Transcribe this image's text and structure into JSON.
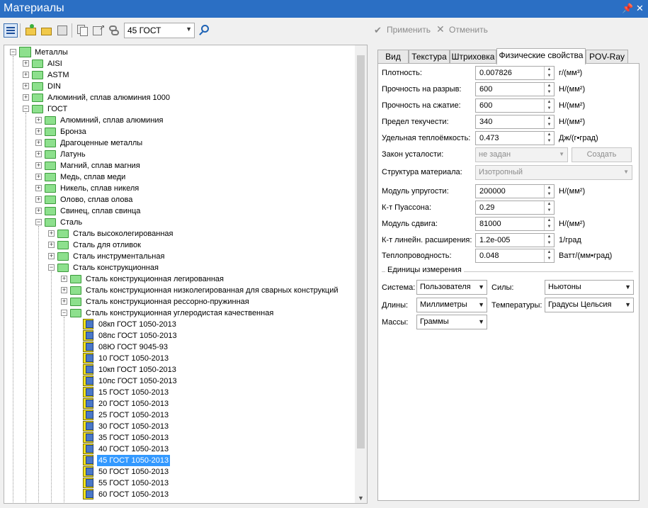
{
  "window": {
    "title": "Материалы",
    "pin_glyph": "📌",
    "close_glyph": "✕"
  },
  "toolbar": {
    "material_combo": "45 ГОСТ",
    "apply_label": "Применить",
    "cancel_label": "Отменить"
  },
  "tree": {
    "nodes": [
      {
        "label": "Металлы",
        "level": 0,
        "type": "root",
        "expanded": true
      },
      {
        "label": "AISI",
        "level": 1,
        "type": "folder",
        "expanded": false
      },
      {
        "label": "ASTM",
        "level": 1,
        "type": "folder",
        "expanded": false
      },
      {
        "label": "DIN",
        "level": 1,
        "type": "folder",
        "expanded": false
      },
      {
        "label": "Алюминий, сплав алюминия 1000",
        "level": 1,
        "type": "folder",
        "expanded": false
      },
      {
        "label": "ГОСТ",
        "level": 1,
        "type": "folder",
        "expanded": true
      },
      {
        "label": "Алюминий, сплав алюминия",
        "level": 2,
        "type": "folder",
        "expanded": false
      },
      {
        "label": "Бронза",
        "level": 2,
        "type": "folder",
        "expanded": false
      },
      {
        "label": "Драгоценные металлы",
        "level": 2,
        "type": "folder",
        "expanded": false
      },
      {
        "label": "Латунь",
        "level": 2,
        "type": "folder",
        "expanded": false
      },
      {
        "label": "Магний, сплав магния",
        "level": 2,
        "type": "folder",
        "expanded": false
      },
      {
        "label": "Медь, сплав меди",
        "level": 2,
        "type": "folder",
        "expanded": false
      },
      {
        "label": "Никель, сплав никеля",
        "level": 2,
        "type": "folder",
        "expanded": false
      },
      {
        "label": "Олово, сплав олова",
        "level": 2,
        "type": "folder",
        "expanded": false
      },
      {
        "label": "Свинец, сплав свинца",
        "level": 2,
        "type": "folder",
        "expanded": false
      },
      {
        "label": "Сталь",
        "level": 2,
        "type": "folder",
        "expanded": true
      },
      {
        "label": "Сталь высоколегированная",
        "level": 3,
        "type": "folder",
        "expanded": false
      },
      {
        "label": "Сталь для отливок",
        "level": 3,
        "type": "folder",
        "expanded": false
      },
      {
        "label": "Сталь инструментальная",
        "level": 3,
        "type": "folder",
        "expanded": false
      },
      {
        "label": "Сталь конструкционная",
        "level": 3,
        "type": "folder",
        "expanded": true
      },
      {
        "label": "Сталь конструкционная легированная",
        "level": 4,
        "type": "folder",
        "expanded": false
      },
      {
        "label": "Сталь конструкционная низколегированная для сварных конструкций",
        "level": 4,
        "type": "folder",
        "expanded": false
      },
      {
        "label": "Сталь конструкционная рессорно-пружинная",
        "level": 4,
        "type": "folder",
        "expanded": false
      },
      {
        "label": "Сталь конструкционная углеродистая качественная",
        "level": 4,
        "type": "folder",
        "expanded": true
      },
      {
        "label": "08кп ГОСТ 1050-2013",
        "level": 5,
        "type": "material"
      },
      {
        "label": "08пс ГОСТ 1050-2013",
        "level": 5,
        "type": "material"
      },
      {
        "label": "08Ю ГОСТ 9045-93",
        "level": 5,
        "type": "material"
      },
      {
        "label": "10 ГОСТ 1050-2013",
        "level": 5,
        "type": "material"
      },
      {
        "label": "10кп ГОСТ 1050-2013",
        "level": 5,
        "type": "material"
      },
      {
        "label": "10пс ГОСТ 1050-2013",
        "level": 5,
        "type": "material"
      },
      {
        "label": "15 ГОСТ 1050-2013",
        "level": 5,
        "type": "material"
      },
      {
        "label": "20 ГОСТ 1050-2013",
        "level": 5,
        "type": "material"
      },
      {
        "label": "25 ГОСТ 1050-2013",
        "level": 5,
        "type": "material"
      },
      {
        "label": "30 ГОСТ 1050-2013",
        "level": 5,
        "type": "material"
      },
      {
        "label": "35 ГОСТ 1050-2013",
        "level": 5,
        "type": "material"
      },
      {
        "label": "40 ГОСТ 1050-2013",
        "level": 5,
        "type": "material"
      },
      {
        "label": "45 ГОСТ 1050-2013",
        "level": 5,
        "type": "material",
        "selected": true
      },
      {
        "label": "50 ГОСТ 1050-2013",
        "level": 5,
        "type": "material"
      },
      {
        "label": "55 ГОСТ 1050-2013",
        "level": 5,
        "type": "material"
      },
      {
        "label": "60 ГОСТ 1050-2013",
        "level": 5,
        "type": "material"
      }
    ]
  },
  "tabs": [
    "Вид",
    "Текстура",
    "Штриховка",
    "Физические свойства",
    "POV-Ray"
  ],
  "active_tab": "Физические свойства",
  "properties": {
    "density": {
      "label": "Плотность:",
      "value": "0.007826",
      "unit": "г/(мм³)"
    },
    "tensile": {
      "label": "Прочность на разрыв:",
      "value": "600",
      "unit": "Н/(мм²)"
    },
    "compressive": {
      "label": "Прочность на сжатие:",
      "value": "600",
      "unit": "Н/(мм²)"
    },
    "yield": {
      "label": "Предел текучести:",
      "value": "340",
      "unit": "Н/(мм²)"
    },
    "heat_capacity": {
      "label": "Удельная теплоёмкость:",
      "value": "0.473",
      "unit": "Дж/(г•град)"
    },
    "fatigue": {
      "label": "Закон усталости:",
      "value": "не задан",
      "button": "Создать"
    },
    "structure": {
      "label": "Структура материала:",
      "value": "Изотропный"
    },
    "elastic_modulus": {
      "label": "Модуль упругости:",
      "value": "200000",
      "unit": "Н/(мм²)"
    },
    "poisson": {
      "label": "К-т Пуассона:",
      "value": "0.29"
    },
    "shear_modulus": {
      "label": "Модуль сдвига:",
      "value": "81000",
      "unit": "Н/(мм²)"
    },
    "expansion": {
      "label": "К-т линейн. расширения:",
      "value": "1.2e-005",
      "unit": "1/град"
    },
    "conductivity": {
      "label": "Теплопроводность:",
      "value": "0.048",
      "unit": "Ватт/(мм•град)"
    }
  },
  "units": {
    "group_title": "Единицы измерения",
    "system_label": "Система:",
    "system_value": "Пользователя",
    "force_label": "Силы:",
    "force_value": "Ньютоны",
    "length_label": "Длины:",
    "length_value": "Миллиметры",
    "temperature_label": "Температуры:",
    "temperature_value": "Градусы Цельсия",
    "mass_label": "Массы:",
    "mass_value": "Граммы"
  }
}
